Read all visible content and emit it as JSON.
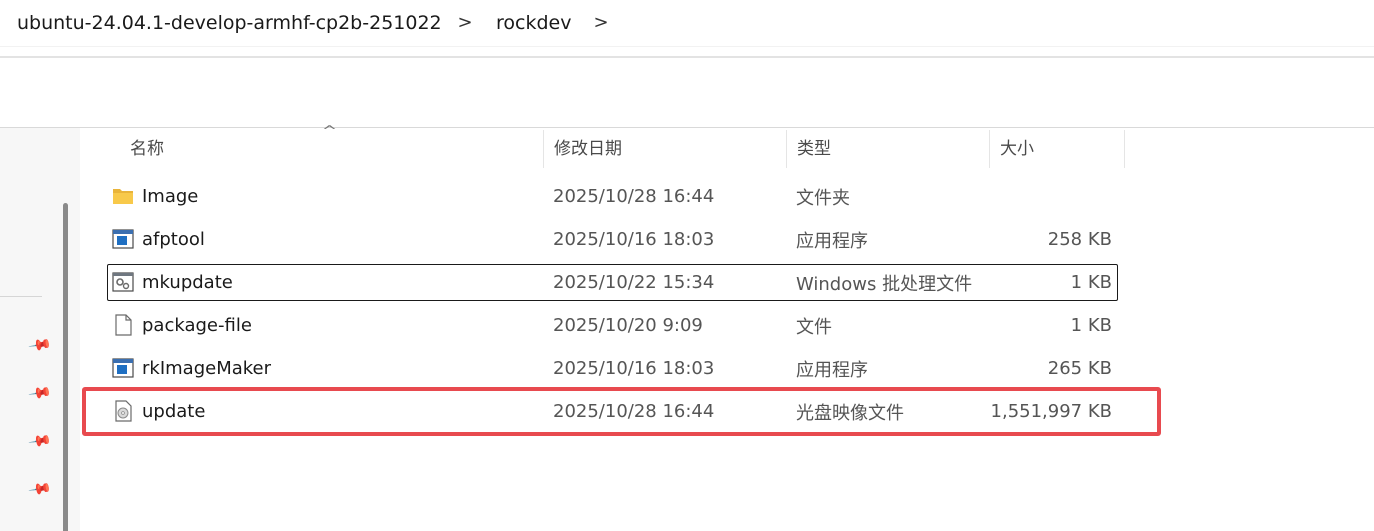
{
  "breadcrumb": {
    "items": [
      {
        "label": "ubuntu-24.04.1-develop-armhf-cp2b-251022"
      },
      {
        "label": "rockdev"
      }
    ],
    "separator": ">"
  },
  "columns": {
    "name": "名称",
    "date": "修改日期",
    "type": "类型",
    "size": "大小"
  },
  "files": [
    {
      "name": "Image",
      "date": "2025/10/28 16:44",
      "type": "文件夹",
      "size": "",
      "icon": "folder-icon"
    },
    {
      "name": "afptool",
      "date": "2025/10/16 18:03",
      "type": "应用程序",
      "size": "258 KB",
      "icon": "application-icon"
    },
    {
      "name": "mkupdate",
      "date": "2025/10/22 15:34",
      "type": "Windows 批处理文件",
      "size": "1 KB",
      "icon": "batch-file-icon"
    },
    {
      "name": "package-file",
      "date": "2025/10/20 9:09",
      "type": "文件",
      "size": "1 KB",
      "icon": "blank-file-icon"
    },
    {
      "name": "rkImageMaker",
      "date": "2025/10/16 18:03",
      "type": "应用程序",
      "size": "265 KB",
      "icon": "application-icon"
    },
    {
      "name": "update",
      "date": "2025/10/28 16:44",
      "type": "光盘映像文件",
      "size": "1,551,997 KB",
      "icon": "disc-image-icon"
    }
  ],
  "colors": {
    "highlight": "#e84a4f",
    "folder": "#f8c94a",
    "app_blue": "#1f6fc2"
  }
}
